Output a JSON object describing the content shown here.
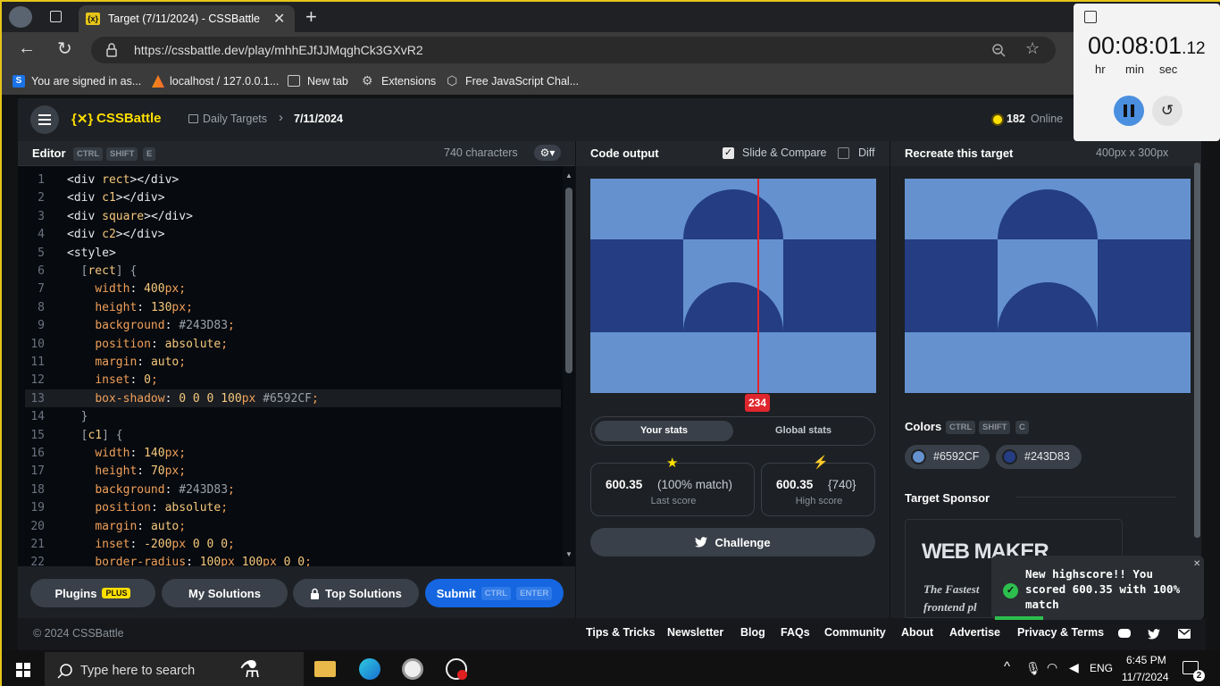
{
  "browser": {
    "tab_title": "Target (7/11/2024) - CSSBattle",
    "url": "https://cssbattle.dev/play/mhhEJfJJMqghCk3GXvR2",
    "bookmarks": [
      "You are signed in as...",
      "localhost / 127.0.0.1...",
      "New tab",
      "Extensions",
      "Free JavaScript Chal..."
    ]
  },
  "timer": {
    "hh": "00",
    "mm": "08",
    "ss": "01",
    "ms": "12",
    "labels": [
      "hr",
      "min",
      "sec"
    ]
  },
  "app": {
    "brand": "CSSBattle",
    "breadcrumb_section": "Daily Targets",
    "breadcrumb_current": "7/11/2024",
    "online_count": "182",
    "online_label": "Online"
  },
  "editor": {
    "title": "Editor",
    "shortcuts": [
      "CTRL",
      "SHIFT",
      "E"
    ],
    "char_count": "740 characters",
    "lines": [
      "<div rect></div>",
      "<div c1></div>",
      "<div square></div>",
      "<div c2></div>",
      "<style>",
      "  [rect] {",
      "    width: 400px;",
      "    height: 130px;",
      "    background: #243D83;",
      "    position: absolute;",
      "    margin: auto;",
      "    inset: 0;",
      "    box-shadow: 0 0 0 100px #6592CF;",
      "  }",
      "  [c1] {",
      "    width: 140px;",
      "    height: 70px;",
      "    background: #243D83;",
      "    position: absolute;",
      "    margin: auto;",
      "    inset: -200px 0 0 0;",
      "    border-radius: 100px 100px 0 0;"
    ]
  },
  "buttons": {
    "plugins": "Plugins",
    "plugins_badge": "PLUS",
    "my_solutions": "My Solutions",
    "top_solutions": "Top Solutions",
    "submit": "Submit",
    "submit_keys": [
      "CTRL",
      "ENTER"
    ]
  },
  "output": {
    "title": "Code output",
    "slide_compare": "Slide & Compare",
    "diff": "Diff",
    "slider_value": "234",
    "tabs": [
      "Your stats",
      "Global stats"
    ],
    "last_score": "600.35",
    "last_match": "(100% match)",
    "last_label": "Last score",
    "high_score": "600.35",
    "high_chars": "{740}",
    "high_label": "High score",
    "challenge": "Challenge"
  },
  "target": {
    "title": "Recreate this target",
    "size": "400px x 300px",
    "colors_label": "Colors",
    "colors_keys": [
      "CTRL",
      "SHIFT",
      "C"
    ],
    "colors": [
      "#6592CF",
      "#243D83"
    ],
    "sponsor_label": "Target Sponsor",
    "sponsor_logo": "WEB MAKER",
    "sponsor_tagline": "The Fastest frontend pl"
  },
  "toast": {
    "message": "New highscore!! You scored 600.35 with 100% match"
  },
  "footer": {
    "copyright": "© 2024 CSSBattle",
    "links": [
      "Tips & Tricks",
      "Newsletter",
      "Blog",
      "FAQs",
      "Community",
      "About",
      "Advertise",
      "Privacy & Terms"
    ]
  },
  "taskbar": {
    "search_placeholder": "Type here to search",
    "lang": "ENG",
    "time": "6:45 PM",
    "date": "11/7/2024",
    "notifications": "2"
  }
}
